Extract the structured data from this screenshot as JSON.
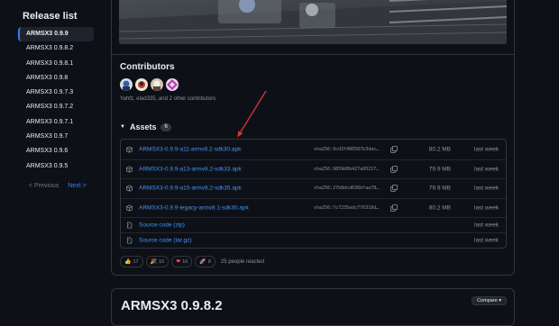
{
  "sidebar": {
    "title": "Release list",
    "items": [
      {
        "label": "ARMSX3 0.9.9"
      },
      {
        "label": "ARMSX3 0.9.8.2"
      },
      {
        "label": "ARMSX3 0.9.8.1"
      },
      {
        "label": "ARMSX3 0.9.8"
      },
      {
        "label": "ARMSX3 0.9.7.3"
      },
      {
        "label": "ARMSX3 0.9.7.2"
      },
      {
        "label": "ARMSX3 0.9.7.1"
      },
      {
        "label": "ARMSX3 0.9.7"
      },
      {
        "label": "ARMSX3 0.9.6"
      },
      {
        "label": "ARMSX3 0.9.5"
      }
    ],
    "previous_label": "< Previous",
    "next_label": "Next >"
  },
  "release": {
    "contributors_title": "Contributors",
    "contributors_text": "Yahfz, elad335, and 2 other contributors",
    "assets_title": "Assets",
    "assets_count": "6",
    "assets": [
      {
        "name": "ARMSX3-0.9.9-a11-armv8.2-sdk30.apk",
        "sha": "sha256:9cd3f480587b3dac…",
        "size": "80.2 MB",
        "date": "last week"
      },
      {
        "name": "ARMSX3-0.9.9-a13-armv8.2-sdk33.apk",
        "sha": "sha256:9859d0b427a95217…",
        "size": "79.9 MB",
        "date": "last week"
      },
      {
        "name": "ARMSX3-0.9.9-a15-armv8.2-sdk35.apk",
        "sha": "sha256:27b8dcd636bfaa78…",
        "size": "79.9 MB",
        "date": "last week"
      },
      {
        "name": "ARMSX3-0.9.9-legacy-armv8.1-sdk30.apk",
        "sha": "sha256:7c7235edc770316d…",
        "size": "80.2 MB",
        "date": "last week"
      }
    ],
    "source_zip": {
      "name": "Source code (zip)",
      "date": "last week"
    },
    "source_tar": {
      "name": "Source code (tar.gz)",
      "date": "last week"
    },
    "reactions": [
      {
        "emoji": "👍",
        "count": "17"
      },
      {
        "emoji": "🎉",
        "count": "10"
      },
      {
        "emoji": "❤",
        "count": "10"
      },
      {
        "emoji": "🚀",
        "count": "8"
      }
    ],
    "reactions_text": "25 people reacted"
  },
  "next_release": {
    "title": "ARMSX3 0.9.8.2",
    "compare_label": "Compare ▾"
  },
  "colors": {
    "background": "#0d1117",
    "link": "#4493f8",
    "border": "#30363d",
    "annotation_arrow": "#da3633"
  }
}
